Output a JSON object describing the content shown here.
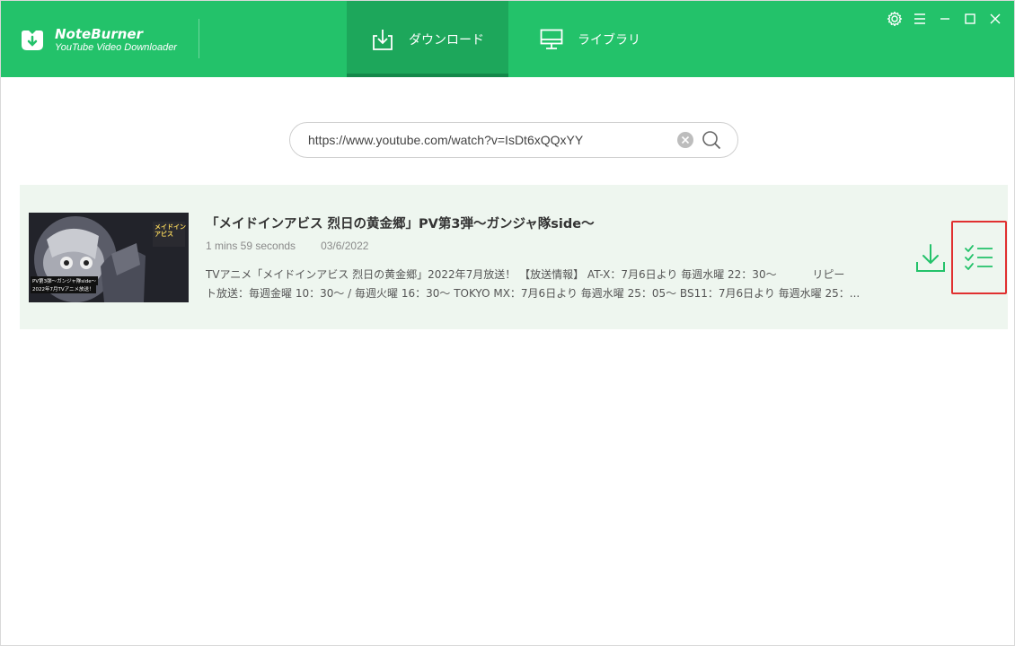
{
  "app": {
    "name": "NoteBurner",
    "subtitle": "YouTube Video Downloader"
  },
  "tabs": [
    {
      "label": "ダウンロード",
      "icon": "download-icon",
      "active": true
    },
    {
      "label": "ライブラリ",
      "icon": "monitor-icon",
      "active": false
    }
  ],
  "window_controls": [
    "gear-icon",
    "menu-icon",
    "minimize-icon",
    "maximize-icon",
    "close-icon"
  ],
  "search": {
    "value": "https://www.youtube.com/watch?v=IsDt6xQQxYY",
    "clear_icon": "clear-icon",
    "search_icon": "search-icon"
  },
  "video": {
    "title": "「メイドインアビス 烈日の黄金郷」PV第3弾～ガンジャ隊side～",
    "duration": "1 mins 59 seconds",
    "date": "03/6/2022",
    "description_line1": "TVアニメ「メイドインアビス 烈日の黄金郷」2022年7月放送！ 【放送情報】 AT-X：7月6日より 毎週水曜 22：30～ 　　　リピー",
    "description_line2": "ト放送：毎週金曜 10：30～ / 毎週火曜 16：30～ TOKYO MX：7月6日より 毎週水曜 25：05～ BS11：7月6日より 毎週水曜 25：...",
    "thumbnail_caption1": "PV第3弾～ガンジャ隊side～",
    "thumbnail_caption2": "2022年7月TVアニメ放送！",
    "thumbnail_logo": "メイドインアビス"
  },
  "colors": {
    "header": "#23c26a",
    "active_tab": "#1da75b",
    "row_bg": "#eef6ef",
    "accent": "#23c26a",
    "highlight_box": "#e03030"
  }
}
